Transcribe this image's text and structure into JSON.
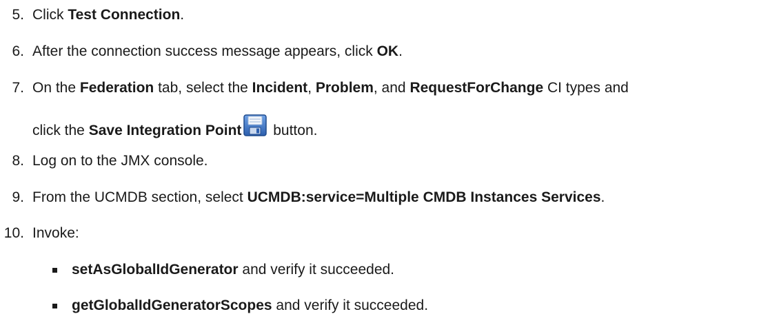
{
  "steps": [
    {
      "number": "5.",
      "parts": [
        "Click ",
        "Test Connection",
        "."
      ]
    },
    {
      "number": "6.",
      "parts": [
        "After the connection success message appears, click ",
        "OK",
        "."
      ]
    },
    {
      "number": "7.",
      "line1": [
        "On the ",
        "Federation",
        " tab, select the ",
        "Incident",
        ", ",
        "Problem",
        ", and ",
        "RequestForChange",
        " CI types and"
      ],
      "line2": [
        "click the ",
        "Save Integration Point",
        " button."
      ],
      "icon": "save-floppy-icon"
    },
    {
      "number": "8.",
      "parts": [
        "Log on to the JMX console."
      ]
    },
    {
      "number": "9.",
      "parts": [
        "From the UCMDB section, select ",
        "UCMDB:service=Multiple CMDB Instances Services",
        "."
      ]
    },
    {
      "number": "10.",
      "parts": [
        "Invoke:"
      ]
    }
  ],
  "bullets": [
    {
      "parts": [
        "setAsGlobalIdGenerator",
        " and verify it succeeded."
      ]
    },
    {
      "parts": [
        "getGlobalIdGeneratorScopes",
        " and verify it succeeded."
      ]
    }
  ],
  "colors": {
    "text": "#1a1a1a",
    "icon_blue": "#3b73c4"
  }
}
